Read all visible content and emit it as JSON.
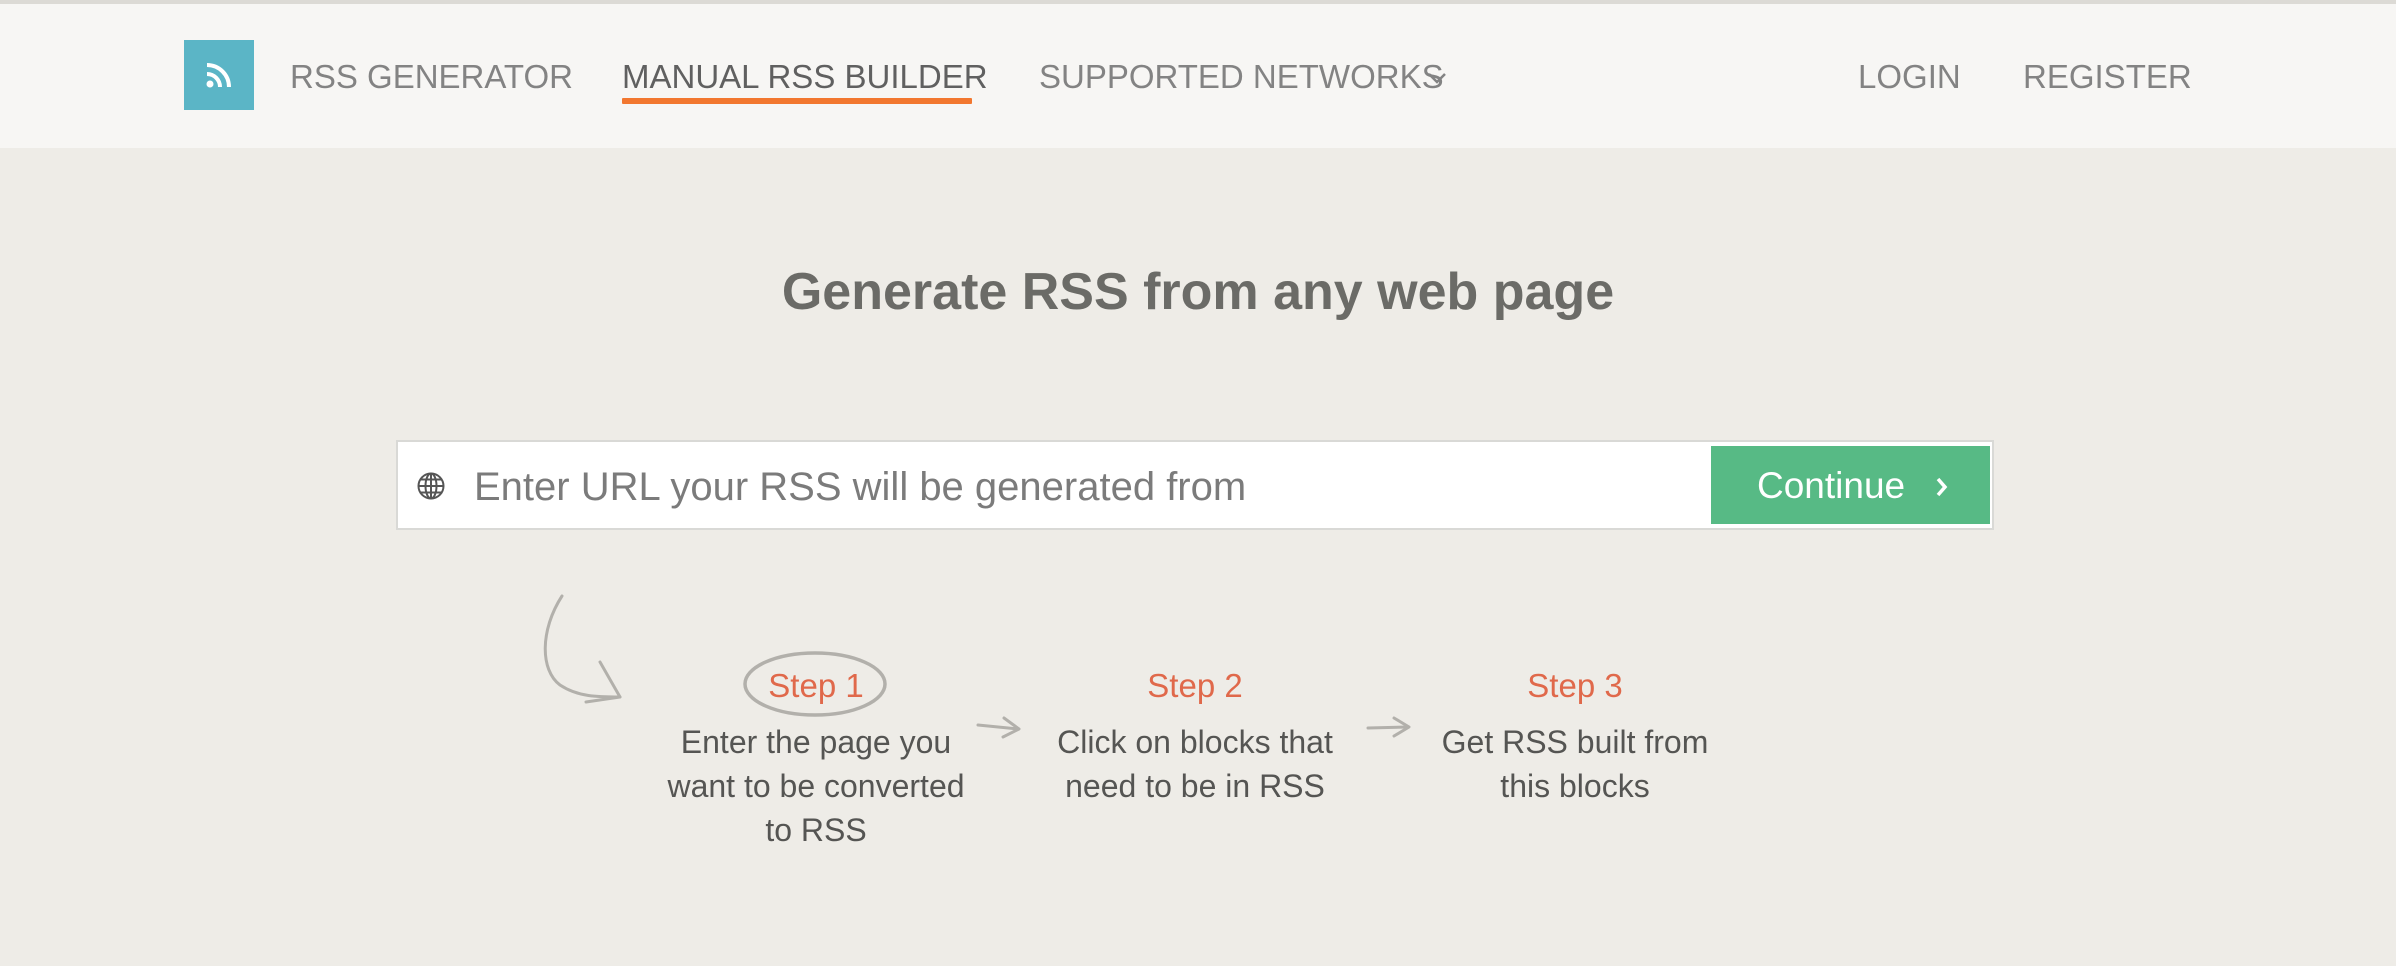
{
  "nav": {
    "logo_icon": "rss-feed-icon",
    "items": [
      {
        "label": "RSS GENERATOR"
      },
      {
        "label": "MANUAL RSS BUILDER",
        "active": true
      },
      {
        "label": "SUPPORTED NETWORKS",
        "dropdown": true
      }
    ],
    "login_label": "LOGIN",
    "register_label": "REGISTER",
    "accent_color": "#f2772f",
    "logo_color": "#5bb5c6"
  },
  "hero": {
    "title": "Generate RSS from any web page"
  },
  "url_form": {
    "icon": "globe-icon",
    "value": "",
    "placeholder": "Enter URL your RSS will be generated from",
    "button_label": "Continue",
    "button_icon": "chevron-right-icon",
    "button_color": "#57ba85"
  },
  "steps": [
    {
      "title": "Step 1",
      "description": "Enter the page you want to be converted to RSS"
    },
    {
      "title": "Step 2",
      "description": "Click on blocks that need to be in RSS"
    },
    {
      "title": "Step 3",
      "description": "Get RSS built from this blocks"
    }
  ],
  "colors": {
    "step_title": "#e0694b",
    "background": "#eeece7"
  }
}
